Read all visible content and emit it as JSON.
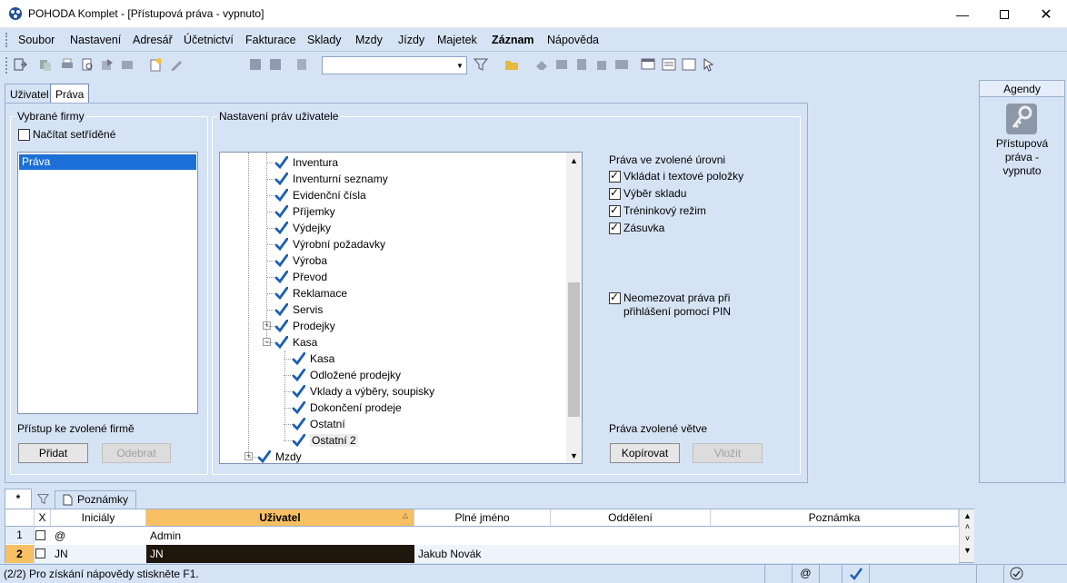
{
  "window": {
    "title": "POHODA Komplet - [Přístupová práva - vypnuto]"
  },
  "menu": [
    "Soubor",
    "Nastavení",
    "Adresář",
    "Účetnictví",
    "Fakturace",
    "Sklady",
    "Mzdy",
    "Jízdy",
    "Majetek",
    "Záznam",
    "Nápověda"
  ],
  "tabs": {
    "uzivatel": "Uživatel",
    "prava": "Práva"
  },
  "firms": {
    "legend": "Vybrané firmy",
    "sorted_label": "Načítat setříděné",
    "items": [
      "Práva"
    ],
    "access_label": "Přístup ke zvolené firmě",
    "add_button": "Přidat",
    "remove_button": "Odebrat"
  },
  "rights": {
    "legend": "Nastavení práv uživatele",
    "tree": [
      {
        "label": "Inventura"
      },
      {
        "label": "Inventurní seznamy"
      },
      {
        "label": "Evidenční čísla"
      },
      {
        "label": "Příjemky"
      },
      {
        "label": "Výdejky"
      },
      {
        "label": "Výrobní požadavky"
      },
      {
        "label": "Výroba"
      },
      {
        "label": "Převod"
      },
      {
        "label": "Reklamace"
      },
      {
        "label": "Servis"
      },
      {
        "label": "Prodejky"
      },
      {
        "label": "Kasa"
      },
      {
        "label": "Kasa"
      },
      {
        "label": "Odložené prodejky"
      },
      {
        "label": "Vklady a výběry, soupisky"
      },
      {
        "label": "Dokončení prodeje"
      },
      {
        "label": "Ostatní"
      },
      {
        "label": "Ostatní 2"
      },
      {
        "label": "Mzdy"
      }
    ],
    "level_title": "Práva ve zvolené úrovni",
    "options": [
      "Vkládat i textové položky",
      "Výběr skladu",
      "Tréninkový režim",
      "Zásuvka"
    ],
    "pin_line1": "Neomezovat práva při",
    "pin_line2": "přihlášení pomocí PIN",
    "branch_title": "Práva zvolené větve",
    "copy_button": "Kopírovat",
    "paste_button": "Vložit"
  },
  "agenda": {
    "header": "Agendy",
    "line1": "Přístupová",
    "line2": "práva -",
    "line3": "vypnuto"
  },
  "bottom_tabs": {
    "star": "*",
    "notes": "Poznámky"
  },
  "grid": {
    "columns": {
      "x": "X",
      "initials": "Iniciály",
      "user": "Uživatel",
      "fullname": "Plné jméno",
      "dept": "Oddělení",
      "note": "Poznámka"
    },
    "rows": [
      {
        "num": "1",
        "initials": "@",
        "user": "Admin",
        "fullname": "",
        "dept": "",
        "note": ""
      },
      {
        "num": "2",
        "initials": "JN",
        "user": "JN",
        "fullname": "Jakub Novák",
        "dept": "",
        "note": ""
      }
    ]
  },
  "status": {
    "text": "(2/2) Pro získání nápovědy stiskněte F1.",
    "at": "@"
  }
}
